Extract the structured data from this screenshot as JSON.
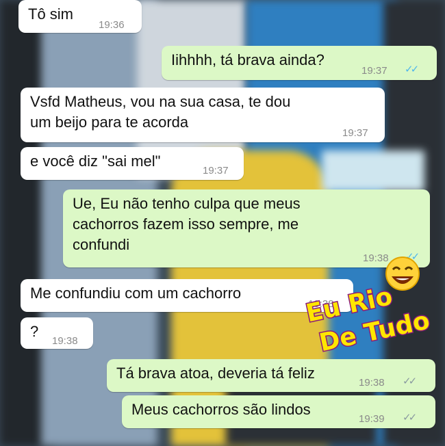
{
  "messages": [
    {
      "text": "Tô sim",
      "time": "19:36",
      "side": "in"
    },
    {
      "text": "Iihhhh, tá brava ainda?",
      "time": "19:37",
      "side": "out",
      "ticks": "blue"
    },
    {
      "text": "Vsfd Matheus,  vou na sua casa, te dou\num beijo para te acorda",
      "time": "19:37",
      "side": "in"
    },
    {
      "text": "e você diz \"sai mel\"",
      "time": "19:37",
      "side": "in"
    },
    {
      "text": "Ue, Eu não tenho culpa que meus\ncachorros fazem isso sempre, me\nconfundi",
      "time": "19:38",
      "side": "out",
      "ticks": "blue"
    },
    {
      "text": "Me confundiu com um cachorro",
      "time": "19:38",
      "side": "in"
    },
    {
      "text": "?",
      "time": "19:38",
      "side": "in"
    },
    {
      "text": "Tá brava atoa, deveria tá feliz",
      "time": "19:38",
      "side": "out",
      "ticks": "grey"
    },
    {
      "text": "Meus cachorros são lindos",
      "time": "19:39",
      "side": "out",
      "ticks": "grey"
    }
  ],
  "watermark": {
    "line1": "Eu Rio",
    "line2": "De Tudo"
  },
  "icons": {
    "read_ticks": "double-check-icon",
    "watermark_face": "laughing-emoji-icon"
  },
  "colors": {
    "incoming": "#ffffff",
    "outgoing": "#dcf8c6",
    "read": "#4fb6ec"
  }
}
